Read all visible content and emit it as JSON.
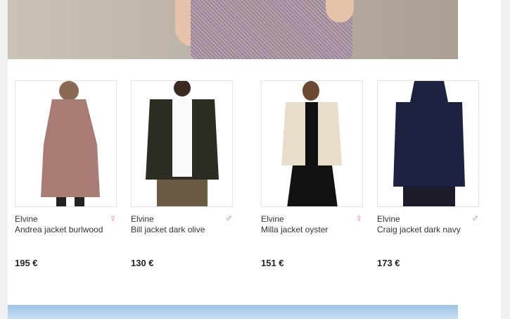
{
  "products": [
    {
      "brand": "Elvine",
      "name": "Andrea jacket burlwood",
      "gender": "♀",
      "price": "195 €",
      "jacket_color": "#a87c75"
    },
    {
      "brand": "Elvine",
      "name": "Bill jacket dark olive",
      "gender": "♂",
      "price": "130 €",
      "jacket_color": "#2c2c22"
    },
    {
      "brand": "Elvine",
      "name": "Milla jacket oyster",
      "gender": "♀",
      "price": "151 €",
      "jacket_color": "#e8dccb"
    },
    {
      "brand": "Elvine",
      "name": "Craig jacket dark navy",
      "gender": "♂",
      "price": "173 €",
      "jacket_color": "#1f2140"
    }
  ],
  "colors": {
    "female": "#d77cc9",
    "male": "#6e97c4"
  }
}
